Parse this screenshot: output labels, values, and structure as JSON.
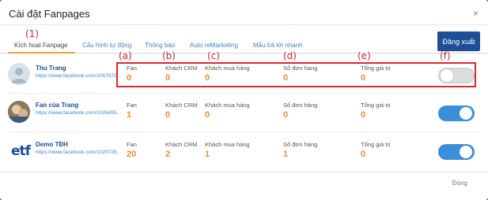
{
  "modal": {
    "title": "Cài đặt Fanpages",
    "close_glyph": "×",
    "footer_close_label": "Đóng"
  },
  "tabs": [
    {
      "label": "Kích hoạt Fanpage",
      "active": true
    },
    {
      "label": "Cấu hình tự động",
      "active": false
    },
    {
      "label": "Thông báo",
      "active": false
    },
    {
      "label": "Auto reMarketing",
      "active": false
    },
    {
      "label": "Mẫu trả lời nhanh",
      "active": false
    }
  ],
  "logout_label": "Đăng xuất",
  "annotations": {
    "tab_marker": "(1)",
    "col_a": "(a)",
    "col_b": "(b)",
    "col_c": "(c)",
    "col_d": "(d)",
    "col_e": "(e)",
    "col_f": "(f)",
    "color": "#e2262c"
  },
  "stat_labels": {
    "fan": "Fan",
    "crm": "Khách CRM",
    "buyers": "Khách mua hàng",
    "orders": "Số đơn hàng",
    "value": "Tổng giá trị"
  },
  "pages": [
    {
      "name": "Thu Trang",
      "url": "https://www.facebook.com/1067970...",
      "avatar_icon": "default-user-icon",
      "fan": "0",
      "crm": "0",
      "buyers": "0",
      "orders": "0",
      "value": "0",
      "enabled": false
    },
    {
      "name": "Fan của Trang",
      "url": "https://www.facebook.com/1026455...",
      "avatar_icon": "profile-photo",
      "fan": "1",
      "crm": "0",
      "buyers": "0",
      "orders": "0",
      "value": "0",
      "enabled": true
    },
    {
      "name": "Demo TĐH",
      "url": "https://www.facebook.com/1029728...",
      "avatar_icon": "etf-logo",
      "avatar_logo_text": "etf",
      "fan": "20",
      "crm": "2",
      "buyers": "1",
      "orders": "1",
      "value": "0",
      "enabled": true
    }
  ],
  "colors": {
    "accent_blue": "#1e4e96",
    "link_blue": "#3a87c9",
    "value_orange": "#f28c28",
    "toggle_on": "#3a8fd9"
  }
}
